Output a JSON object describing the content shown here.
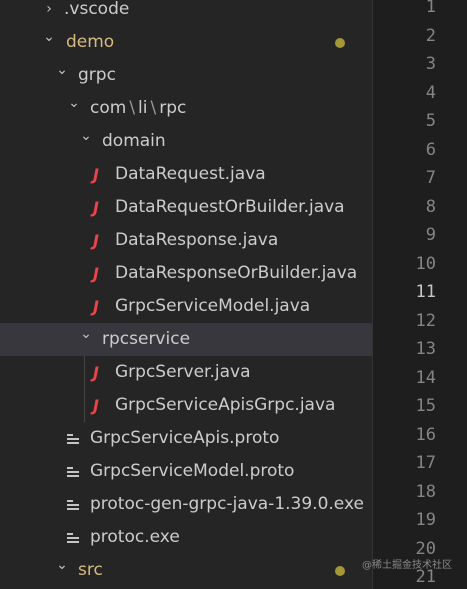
{
  "tree": {
    "vscode": {
      "label": ".vscode"
    },
    "demo": {
      "label": "demo"
    },
    "grpc": {
      "label": "grpc"
    },
    "com_path": {
      "segments": [
        "com",
        "li",
        "rpc"
      ],
      "separator": "\\"
    },
    "domain": {
      "label": "domain"
    },
    "domain_files": [
      {
        "label": "DataRequest.java",
        "icon": "java-icon"
      },
      {
        "label": "DataRequestOrBuilder.java",
        "icon": "java-icon"
      },
      {
        "label": "DataResponse.java",
        "icon": "java-icon"
      },
      {
        "label": "DataResponseOrBuilder.java",
        "icon": "java-icon"
      },
      {
        "label": "GrpcServiceModel.java",
        "icon": "java-icon"
      }
    ],
    "rpcservice": {
      "label": "rpcservice"
    },
    "rpcservice_files": [
      {
        "label": "GrpcServer.java",
        "icon": "java-icon"
      },
      {
        "label": "GrpcServiceApisGrpc.java",
        "icon": "java-icon"
      }
    ],
    "grpc_files": [
      {
        "label": "GrpcServiceApis.proto",
        "icon": "lines-icon"
      },
      {
        "label": "GrpcServiceModel.proto",
        "icon": "lines-icon"
      },
      {
        "label": "protoc-gen-grpc-java-1.39.0.exe",
        "icon": "lines-icon"
      },
      {
        "label": "protoc.exe",
        "icon": "lines-icon"
      }
    ],
    "src": {
      "label": "src"
    },
    "java_glyph": "J",
    "chevron_right": "›",
    "chevron_down": "⌄"
  },
  "gutter": {
    "line_numbers": [
      "1",
      "2",
      "3",
      "4",
      "5",
      "6",
      "7",
      "8",
      "9",
      "10",
      "11",
      "12",
      "13",
      "14",
      "15",
      "16",
      "17",
      "18",
      "19",
      "20",
      "21"
    ],
    "active_line": "11"
  },
  "watermark": {
    "text": "@稀土掘金技术社区"
  },
  "colors": {
    "explorer_bg": "#252526",
    "editor_bg": "#1e1e1e",
    "selected_bg": "#37373d",
    "modified_text": "#d7ba7d",
    "modified_dot": "#a39736",
    "java_icon": "#e8444a"
  }
}
